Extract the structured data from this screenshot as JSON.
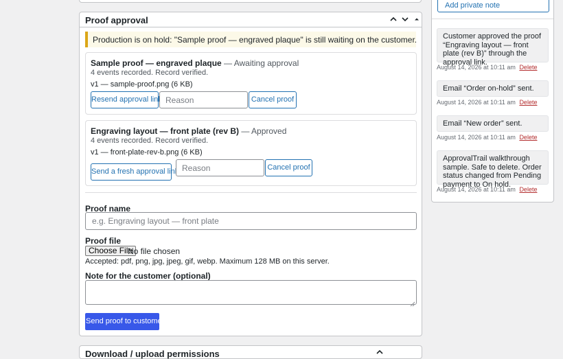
{
  "proof_approval": {
    "title": "Proof approval",
    "notice": "Production is on hold: \"Sample proof — engraved plaque\" is still waiting on the customer.",
    "proofs": [
      {
        "name": "Sample proof — engraved plaque",
        "status": " — Awaiting approval",
        "events": "4 events recorded. Record verified.",
        "file": "v1 — sample-proof.png (6 KB)",
        "resend_label": "Resend approval link",
        "reason_placeholder": "Reason",
        "cancel_label": "Cancel proof"
      },
      {
        "name": "Engraving layout — front plate (rev B)",
        "status": " — Approved",
        "events": "4 events recorded. Record verified.",
        "file": "v1 — front-plate-rev-b.png (6 KB)",
        "resend_label": "Send a fresh approval link",
        "reason_placeholder": "Reason",
        "cancel_label": "Cancel proof"
      }
    ],
    "form": {
      "proof_name_label": "Proof name",
      "proof_name_placeholder": "e.g. Engraving layout — front plate",
      "proof_file_label": "Proof file",
      "choose_file_label": "Choose File",
      "no_file_text": "No file chosen",
      "accepted_text": "Accepted: pdf, png, jpg, jpeg, gif, webp. Maximum 128 MB on this server.",
      "note_label": "Note for the customer (optional)",
      "submit_label": "Send proof to customer"
    }
  },
  "next_box": {
    "title": "Download / upload permissions"
  },
  "order_notes": {
    "add_note_label": "Add private note",
    "notes": [
      {
        "text": "Customer approved the proof “Engraving layout — front plate (rev B)” through the approval link.",
        "date": "August 14, 2026 at 10:11 am",
        "delete": "Delete"
      },
      {
        "text": "Email “Order on-hold” sent.",
        "date": "August 14, 2026 at 10:11 am",
        "delete": "Delete"
      },
      {
        "text": "Email “New order” sent.",
        "date": "August 14, 2026 at 10:11 am",
        "delete": "Delete"
      },
      {
        "text": "ApprovalTrail walkthrough sample. Safe to delete. Order status changed from Pending payment to On hold.",
        "date": "August 14, 2026 at 10:11 am",
        "delete": "Delete"
      }
    ]
  },
  "colors": {
    "accent": "#2271b1",
    "primary_button": "#3858e9",
    "notice_border": "#dba617",
    "delete_link": "#b32d2e"
  }
}
